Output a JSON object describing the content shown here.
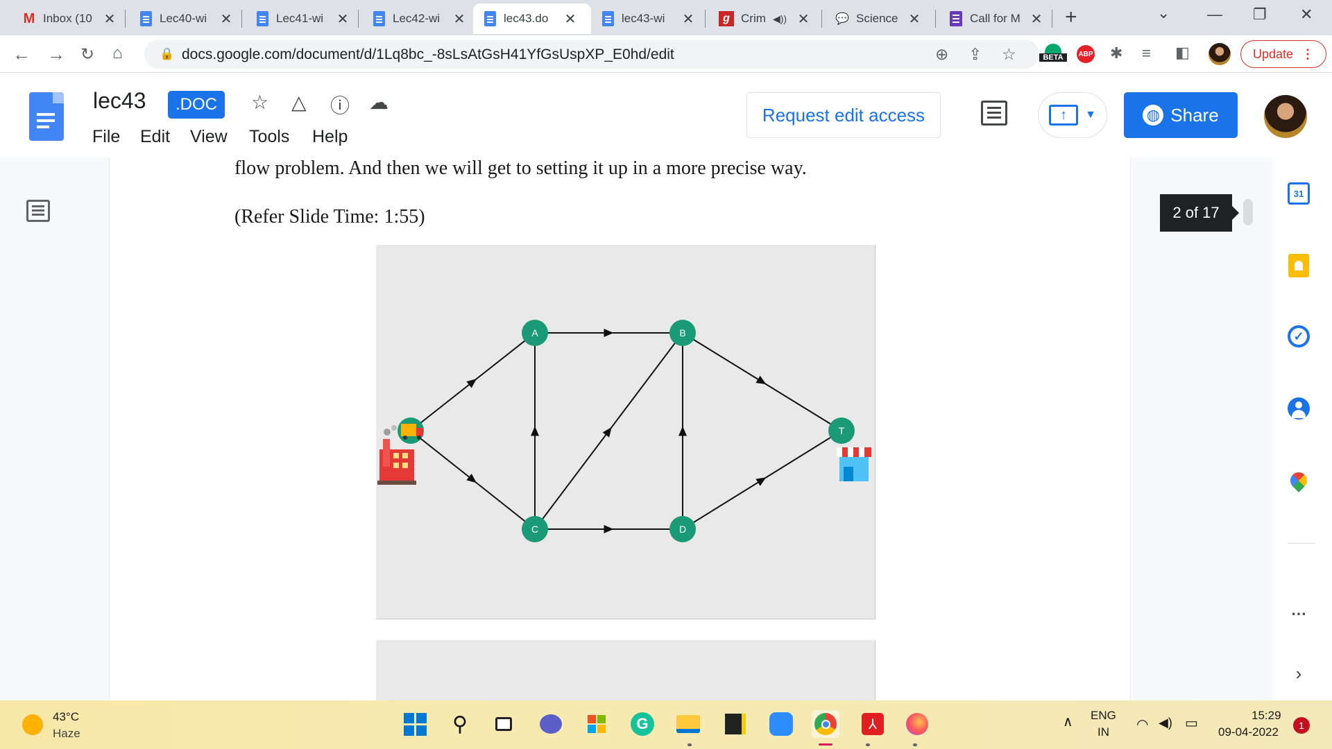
{
  "browser": {
    "tabs": [
      {
        "label": "Inbox (10",
        "icon": "gmail-icon",
        "active": false
      },
      {
        "label": "Lec40-wi",
        "icon": "docs-icon",
        "active": false
      },
      {
        "label": "Lec41-wi",
        "icon": "docs-icon",
        "active": false
      },
      {
        "label": "Lec42-wi",
        "icon": "docs-icon",
        "active": false
      },
      {
        "label": "lec43.do",
        "icon": "docs-icon",
        "active": true
      },
      {
        "label": "lec43-wi",
        "icon": "docs-icon",
        "active": false
      },
      {
        "label": "Crim",
        "icon": "g-icon",
        "active": false
      },
      {
        "label": "Science",
        "icon": "speech-bubble-icon",
        "active": false
      },
      {
        "label": "Call for M",
        "icon": "forms-icon",
        "active": false
      }
    ],
    "new_tab": "+",
    "url": "docs.google.com/document/d/1Lq8bc_-8sLsAtGsH41YfGsUspXP_E0hd/edit",
    "beta_badge": "BETA",
    "abp_badge": "ABP",
    "update_label": "Update"
  },
  "docs": {
    "title": "lec43",
    "badge": ".DOC",
    "menu": [
      "File",
      "Edit",
      "View",
      "Tools",
      "Help"
    ],
    "request_access": "Request edit access",
    "share": "Share",
    "page_counter": "2 of 17",
    "calendar_day": "31"
  },
  "content": {
    "line1": "flow problem. And then we will get to setting it up in a more precise way.",
    "line2": "(Refer Slide Time: 1:55)"
  },
  "diagram": {
    "node_color": "#1a9a76",
    "nodes": [
      {
        "id": "S",
        "label": ""
      },
      {
        "id": "A",
        "label": "A"
      },
      {
        "id": "B",
        "label": "B"
      },
      {
        "id": "C",
        "label": "C"
      },
      {
        "id": "D",
        "label": "D"
      },
      {
        "id": "T",
        "label": "T"
      }
    ],
    "edges": [
      {
        "from": "S",
        "to": "A"
      },
      {
        "from": "S",
        "to": "C"
      },
      {
        "from": "A",
        "to": "B"
      },
      {
        "from": "C",
        "to": "A"
      },
      {
        "from": "C",
        "to": "B"
      },
      {
        "from": "C",
        "to": "D"
      },
      {
        "from": "D",
        "to": "B"
      },
      {
        "from": "B",
        "to": "T"
      },
      {
        "from": "D",
        "to": "T"
      }
    ]
  },
  "taskbar": {
    "weather_temp": "43°C",
    "weather_desc": "Haze",
    "lang_top": "ENG",
    "lang_bottom": "IN",
    "time": "15:29",
    "date": "09-04-2022",
    "notifications": "1"
  }
}
